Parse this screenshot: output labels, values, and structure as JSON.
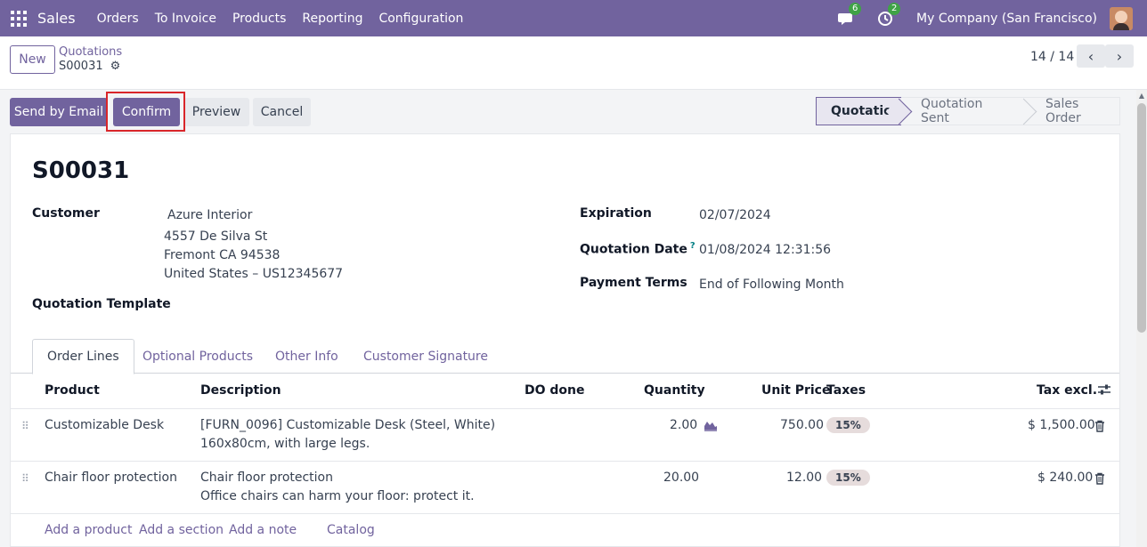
{
  "app": {
    "name": "Sales"
  },
  "menu": [
    "Orders",
    "To Invoice",
    "Products",
    "Reporting",
    "Configuration"
  ],
  "topbar": {
    "messages_count": "6",
    "activities_count": "2",
    "company": "My Company (San Francisco)"
  },
  "controlpanel": {
    "new_label": "New",
    "breadcrumb_parent": "Quotations",
    "breadcrumb_current": "S00031",
    "pager": "14 / 14"
  },
  "actions": {
    "send_email": "Send by Email",
    "confirm": "Confirm",
    "preview": "Preview",
    "cancel": "Cancel"
  },
  "status": [
    "Quotation",
    "Quotation Sent",
    "Sales Order"
  ],
  "record": {
    "name": "S00031",
    "customer_label": "Customer",
    "customer_name": "Azure Interior",
    "address_line1": "4557 De Silva St",
    "address_line2": "Fremont CA 94538",
    "address_line3": "United States – US12345677",
    "template_label": "Quotation Template",
    "expiration_label": "Expiration",
    "expiration": "02/07/2024",
    "quotation_date_label": "Quotation Date",
    "quotation_date_help": "?",
    "quotation_date": "01/08/2024 12:31:56",
    "payment_terms_label": "Payment Terms",
    "payment_terms": "End of Following Month"
  },
  "tabs": [
    "Order Lines",
    "Optional Products",
    "Other Info",
    "Customer Signature"
  ],
  "lines": {
    "headers": {
      "product": "Product",
      "description": "Description",
      "do_done": "DO done",
      "quantity": "Quantity",
      "unit_price": "Unit Price",
      "taxes": "Taxes",
      "tax_excl": "Tax excl."
    },
    "rows": [
      {
        "product": "Customizable Desk",
        "desc1": "[FURN_0096] Customizable Desk (Steel, White)",
        "desc2": "160x80cm, with large legs.",
        "quantity": "2.00",
        "unit_price": "750.00",
        "tax": "15%",
        "subtotal": "$ 1,500.00"
      },
      {
        "product": "Chair floor protection",
        "desc1": "Chair floor protection",
        "desc2": "Office chairs can harm your floor: protect it.",
        "quantity": "20.00",
        "unit_price": "12.00",
        "tax": "15%",
        "subtotal": "$ 240.00"
      }
    ],
    "add_links": {
      "add_product": "Add a product",
      "add_section": "Add a section",
      "add_note": "Add a note",
      "catalog": "Catalog"
    }
  },
  "colors": {
    "brand": "#71639e",
    "highlight": "#d9262a",
    "tax_pill": "#e6dcdc"
  }
}
